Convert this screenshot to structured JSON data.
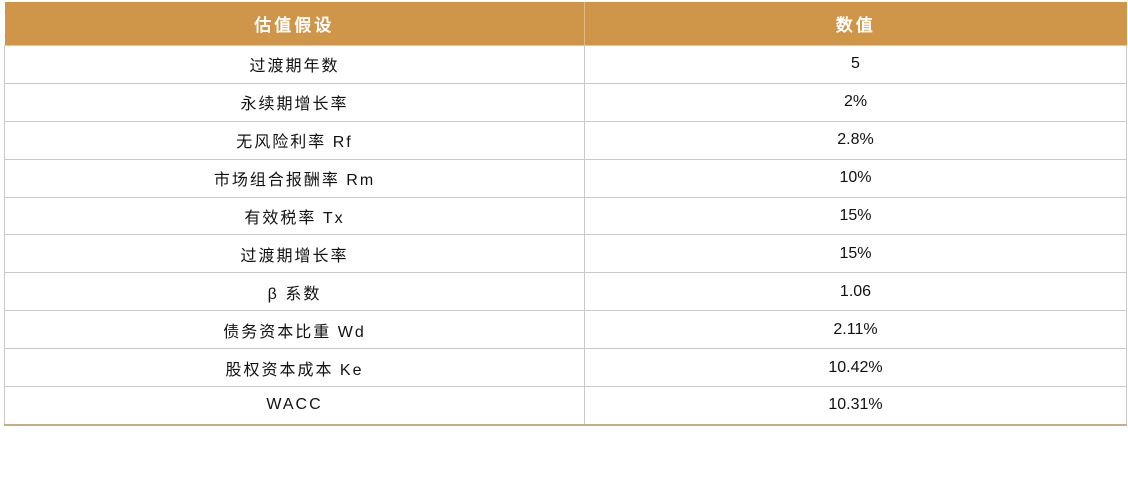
{
  "table": {
    "headers": [
      "估值假设",
      "数值"
    ],
    "rows": [
      {
        "label": "过渡期年数",
        "value": "5"
      },
      {
        "label": "永续期增长率",
        "value": "2%"
      },
      {
        "label": "无风险利率 Rf",
        "value": "2.8%"
      },
      {
        "label": "市场组合报酬率 Rm",
        "value": "10%"
      },
      {
        "label": "有效税率 Tx",
        "value": "15%"
      },
      {
        "label": "过渡期增长率",
        "value": "15%"
      },
      {
        "label": "β 系数",
        "value": "1.06"
      },
      {
        "label": "债务资本比重 Wd",
        "value": "2.11%"
      },
      {
        "label": "股权资本成本 Ke",
        "value": "10.42%"
      },
      {
        "label": "WACC",
        "value": "10.31%"
      }
    ]
  },
  "colors": {
    "header_background": "#cf964a",
    "header_text": "#ffffff",
    "grid_line": "#c9c9c9"
  }
}
